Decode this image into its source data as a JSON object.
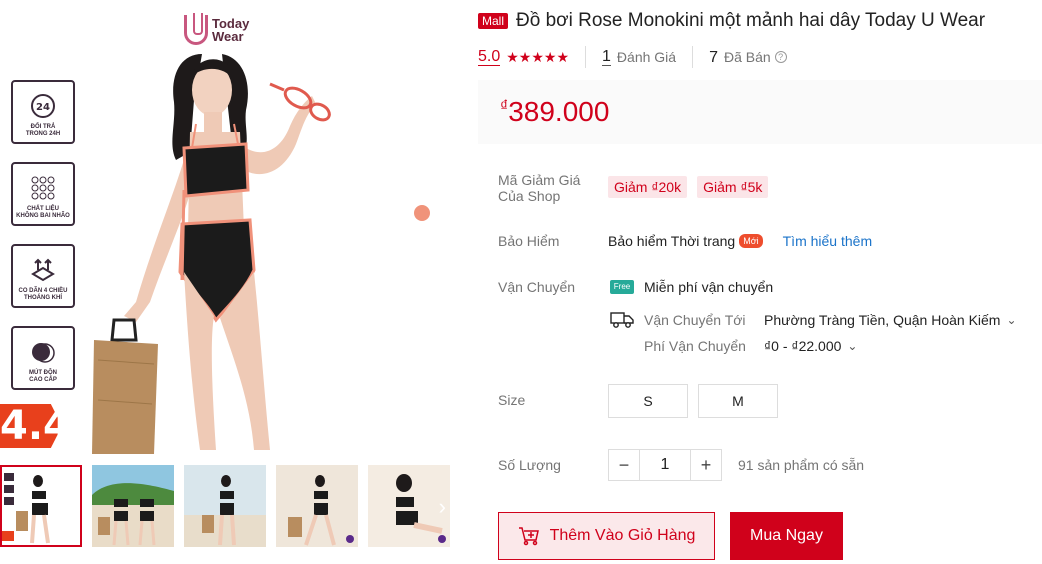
{
  "brand": {
    "line1": "Today",
    "line2": "Wear"
  },
  "badges": [
    {
      "icon": "24h-return-icon",
      "line1": "ĐỔI TRẢ",
      "line2": "TRONG 24H"
    },
    {
      "icon": "fabric-texture-icon",
      "line1": "CHẤT LIỆU",
      "line2": "KHÔNG BAI NHÃO"
    },
    {
      "icon": "stretch-arrows-icon",
      "line1": "CO DÃN 4 CHIỀU",
      "line2": "THOÁNG KHÍ"
    },
    {
      "icon": "padding-icon",
      "line1": "MÚT ĐỘN",
      "line2": "CAO CẤP"
    }
  ],
  "promo": "4.4",
  "product": {
    "mall_tag": "Mall",
    "title": "Đồ bơi Rose Monokini một mảnh hai dây Today U Wear",
    "rating": "5.0",
    "stars": "★★★★★",
    "reviews_count": "1",
    "reviews_label": "Đánh Giá",
    "sold_count": "7",
    "sold_label": "Đã Bán",
    "price": "389.000",
    "currency": "₫"
  },
  "voucher": {
    "label_line1": "Mã Giảm Giá",
    "label_line2": "Của Shop",
    "items": [
      "Giảm ₫20k",
      "Giảm ₫5k"
    ]
  },
  "insurance": {
    "label": "Bảo Hiểm",
    "name": "Bảo hiểm Thời trang",
    "tag": "Mới",
    "link": "Tìm hiểu thêm"
  },
  "shipping": {
    "label": "Vận Chuyển",
    "free_icon": "Free",
    "free_text": "Miễn phí vận chuyển",
    "to_label": "Vận Chuyển Tới",
    "to_value": "Phường Tràng Tiền, Quận Hoàn Kiếm",
    "fee_label": "Phí Vận Chuyển",
    "fee_value": "₫0 - ₫22.000"
  },
  "size": {
    "label": "Size",
    "options": [
      "S",
      "M"
    ]
  },
  "quantity": {
    "label": "Số Lượng",
    "value": "1",
    "minus": "−",
    "plus": "+",
    "stock": "91 sản phẩm có sẵn"
  },
  "actions": {
    "add_to_cart": "Thêm Vào Giỏ Hàng",
    "buy_now": "Mua Ngay"
  },
  "colors": {
    "accent": "#d0011b",
    "voucher_bg": "#fbe5e8",
    "free_ship": "#26aa99",
    "link": "#1a73c9"
  }
}
